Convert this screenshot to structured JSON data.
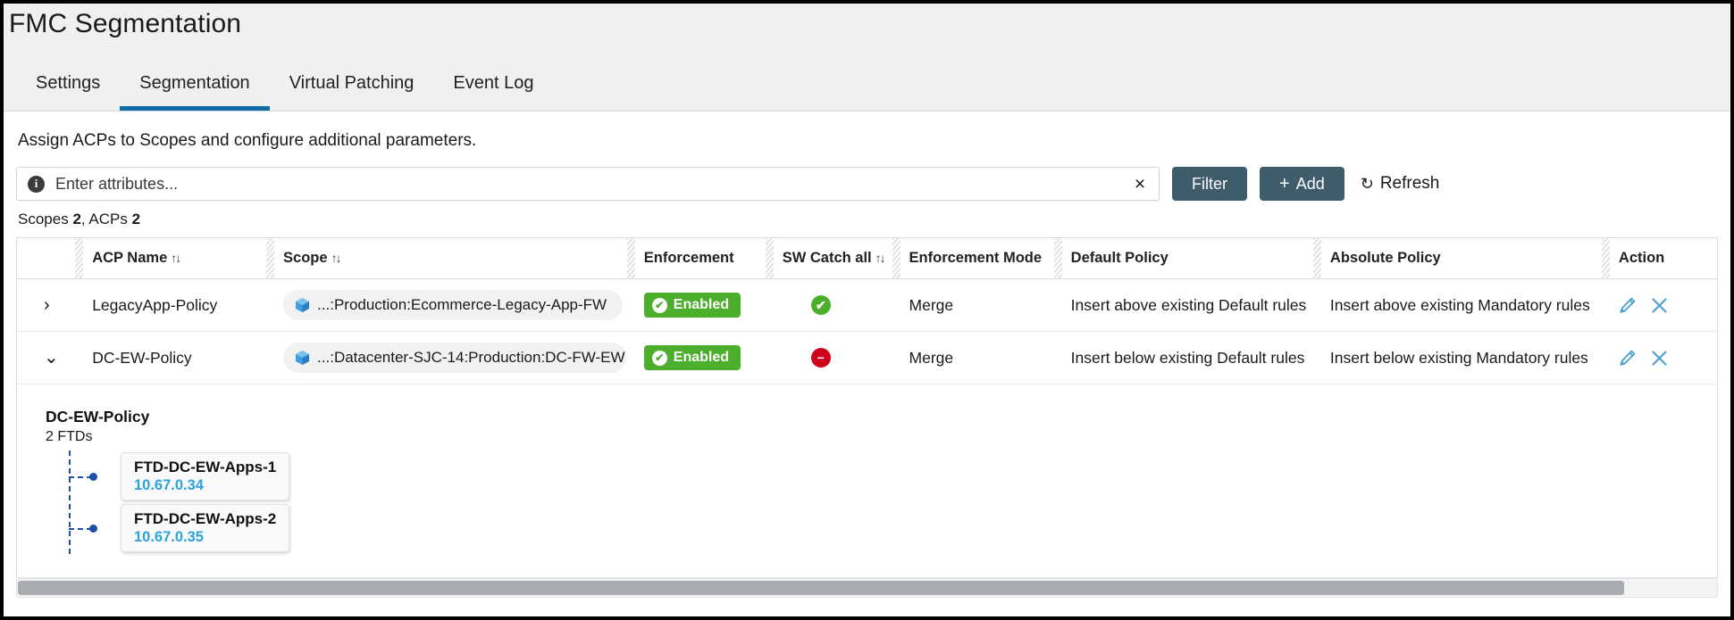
{
  "header": {
    "title": "FMC Segmentation",
    "tabs": [
      {
        "label": "Settings",
        "active": false
      },
      {
        "label": "Segmentation",
        "active": true
      },
      {
        "label": "Virtual Patching",
        "active": false
      },
      {
        "label": "Event Log",
        "active": false
      }
    ]
  },
  "intro": "Assign ACPs to Scopes and configure additional parameters.",
  "filter": {
    "info_icon": "info-icon",
    "placeholder": "Enter attributes...",
    "value": "",
    "clear_icon": "×",
    "filter_label": "Filter",
    "add_label": "Add",
    "add_plus": "+",
    "refresh_label": "Refresh",
    "refresh_glyph": "↻"
  },
  "counts": {
    "scopes_label": "Scopes",
    "scopes_value": "2",
    "separator": ", ",
    "acps_label": "ACPs",
    "acps_value": "2"
  },
  "table": {
    "columns": [
      {
        "label": "",
        "sortable": false
      },
      {
        "label": "ACP Name",
        "sortable": true
      },
      {
        "label": "Scope",
        "sortable": true
      },
      {
        "label": "Enforcement",
        "sortable": false
      },
      {
        "label": "SW Catch all",
        "sortable": true
      },
      {
        "label": "Enforcement Mode",
        "sortable": false
      },
      {
        "label": "Default Policy",
        "sortable": false
      },
      {
        "label": "Absolute Policy",
        "sortable": false
      },
      {
        "label": "Action",
        "sortable": false
      }
    ],
    "sort_glyph": "↑↓",
    "rows": [
      {
        "expanded": false,
        "chevron": "›",
        "acp_name": "LegacyApp-Policy",
        "scope": "...:Production:Ecommerce-Legacy-App-FW",
        "enforcement": "Enabled",
        "enforcement_check": "✔",
        "sw_catch_all": "ok",
        "sw_catch_all_glyph": "✔",
        "enforcement_mode": "Merge",
        "default_policy": "Insert above existing Default rules",
        "absolute_policy": "Insert above existing Mandatory rules",
        "edit_icon": "pencil-icon",
        "delete_icon": "close-icon"
      },
      {
        "expanded": true,
        "chevron": "⌄",
        "acp_name": "DC-EW-Policy",
        "scope": "...:Datacenter-SJC-14:Production:DC-FW-EW",
        "enforcement": "Enabled",
        "enforcement_check": "✔",
        "sw_catch_all": "bad",
        "sw_catch_all_glyph": "−",
        "enforcement_mode": "Merge",
        "default_policy": "Insert below existing Default rules",
        "absolute_policy": "Insert below existing Mandatory rules",
        "edit_icon": "pencil-icon",
        "delete_icon": "close-icon"
      }
    ]
  },
  "detail": {
    "title": "DC-EW-Policy",
    "subtitle": "2 FTDs",
    "devices": [
      {
        "name": "FTD-DC-EW-Apps-1",
        "ip": "10.67.0.34"
      },
      {
        "name": "FTD-DC-EW-Apps-2",
        "ip": "10.67.0.35"
      }
    ]
  },
  "colors": {
    "accent_blue": "#0d6ba8",
    "button_slate": "#3f5c6b",
    "status_green": "#4caf2b",
    "status_red": "#d0021b",
    "link_blue": "#4a9fd4",
    "tree_blue": "#1b4fa8",
    "ip_blue": "#2aa3e0"
  }
}
